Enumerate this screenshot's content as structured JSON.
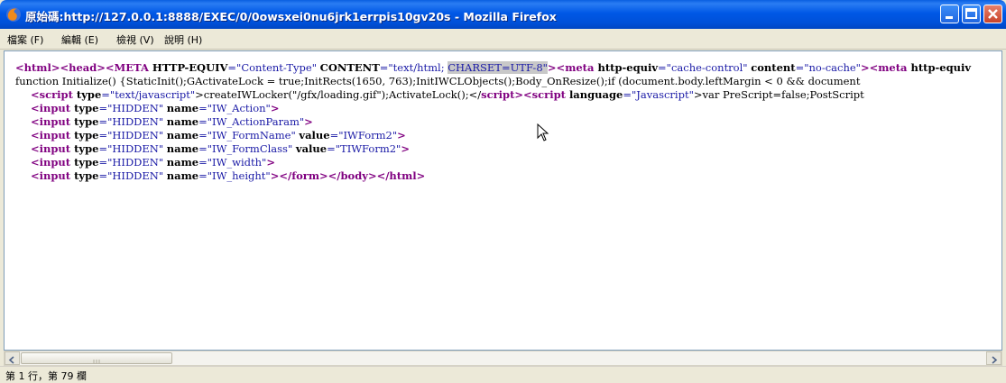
{
  "window": {
    "title": "原始碼:http://127.0.0.1:8888/EXEC/0/0owsxei0nu6jrk1errpis10gv20s - Mozilla Firefox",
    "icon": "firefox-icon"
  },
  "menu": {
    "items": [
      {
        "label": "檔案 (F)"
      },
      {
        "label": "編輯 (E)"
      },
      {
        "label": "檢視 (V)"
      },
      {
        "label": "說明 (H)"
      }
    ]
  },
  "source": {
    "line1": {
      "t1": "<html><head><META ",
      "a1": "HTTP-EQUIV",
      "v1": "=\"Content-Type\" ",
      "a2": "CONTENT",
      "v2": "=\"text/html; ",
      "v3": "CHARSET=UTF-8\"",
      "t2": "><meta ",
      "a3": "http-equiv",
      "v4": "=\"cache-control\" ",
      "a4": "content",
      "v5": "=\"no-cache\"",
      "t3": "><meta ",
      "a5": "http-equiv"
    },
    "line2": "function Initialize() {StaticInit();GActivateLock = true;InitRects(1650, 763);InitIWCLObjects();Body_OnResize();if (document.body.leftMargin < 0 && document",
    "line3": {
      "t1": "<script ",
      "a1": "type",
      "v1": "=\"text/javascript\"",
      "txt": ">createIWLocker(\"/gfx/loading.gif\");ActivateLock();</",
      "t2": "script",
      "t3": "><script ",
      "a2": "language",
      "v2": "=\"Javascript\"",
      "txt2": ">var PreScript=false;PostScript"
    },
    "inputs": [
      {
        "tag": "<input ",
        "a1": "type",
        "v1": "=\"HIDDEN\" ",
        "a2": "name",
        "v2": "=\"IW_Action\"",
        "end": ">"
      },
      {
        "tag": "<input ",
        "a1": "type",
        "v1": "=\"HIDDEN\" ",
        "a2": "name",
        "v2": "=\"IW_ActionParam\"",
        "end": ">"
      },
      {
        "tag": "<input ",
        "a1": "type",
        "v1": "=\"HIDDEN\" ",
        "a2": "name",
        "v2": "=\"IW_FormName\" ",
        "a3": "value",
        "v3": "=\"IWForm2\"",
        "end": ">"
      },
      {
        "tag": "<input ",
        "a1": "type",
        "v1": "=\"HIDDEN\" ",
        "a2": "name",
        "v2": "=\"IW_FormClass\" ",
        "a3": "value",
        "v3": "=\"TIWForm2\"",
        "end": ">"
      },
      {
        "tag": "<input ",
        "a1": "type",
        "v1": "=\"HIDDEN\" ",
        "a2": "name",
        "v2": "=\"IW_width\"",
        "end": ">"
      },
      {
        "tag": "<input ",
        "a1": "type",
        "v1": "=\"HIDDEN\" ",
        "a2": "name",
        "v2": "=\"IW_height\"",
        "end": "></form></body></html>"
      }
    ]
  },
  "status": {
    "text": "第 1 行，第 79 欄"
  },
  "colors": {
    "tag": "#800080",
    "value": "#1a1aa6",
    "titlebar": "#0058e6"
  }
}
